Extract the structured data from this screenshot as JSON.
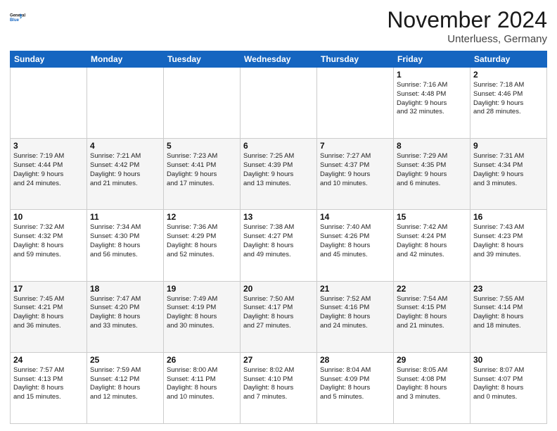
{
  "header": {
    "logo_line1": "General",
    "logo_line2": "Blue",
    "month_title": "November 2024",
    "location": "Unterluess, Germany"
  },
  "days_of_week": [
    "Sunday",
    "Monday",
    "Tuesday",
    "Wednesday",
    "Thursday",
    "Friday",
    "Saturday"
  ],
  "weeks": [
    [
      {
        "day": "",
        "info": ""
      },
      {
        "day": "",
        "info": ""
      },
      {
        "day": "",
        "info": ""
      },
      {
        "day": "",
        "info": ""
      },
      {
        "day": "",
        "info": ""
      },
      {
        "day": "1",
        "info": "Sunrise: 7:16 AM\nSunset: 4:48 PM\nDaylight: 9 hours\nand 32 minutes."
      },
      {
        "day": "2",
        "info": "Sunrise: 7:18 AM\nSunset: 4:46 PM\nDaylight: 9 hours\nand 28 minutes."
      }
    ],
    [
      {
        "day": "3",
        "info": "Sunrise: 7:19 AM\nSunset: 4:44 PM\nDaylight: 9 hours\nand 24 minutes."
      },
      {
        "day": "4",
        "info": "Sunrise: 7:21 AM\nSunset: 4:42 PM\nDaylight: 9 hours\nand 21 minutes."
      },
      {
        "day": "5",
        "info": "Sunrise: 7:23 AM\nSunset: 4:41 PM\nDaylight: 9 hours\nand 17 minutes."
      },
      {
        "day": "6",
        "info": "Sunrise: 7:25 AM\nSunset: 4:39 PM\nDaylight: 9 hours\nand 13 minutes."
      },
      {
        "day": "7",
        "info": "Sunrise: 7:27 AM\nSunset: 4:37 PM\nDaylight: 9 hours\nand 10 minutes."
      },
      {
        "day": "8",
        "info": "Sunrise: 7:29 AM\nSunset: 4:35 PM\nDaylight: 9 hours\nand 6 minutes."
      },
      {
        "day": "9",
        "info": "Sunrise: 7:31 AM\nSunset: 4:34 PM\nDaylight: 9 hours\nand 3 minutes."
      }
    ],
    [
      {
        "day": "10",
        "info": "Sunrise: 7:32 AM\nSunset: 4:32 PM\nDaylight: 8 hours\nand 59 minutes."
      },
      {
        "day": "11",
        "info": "Sunrise: 7:34 AM\nSunset: 4:30 PM\nDaylight: 8 hours\nand 56 minutes."
      },
      {
        "day": "12",
        "info": "Sunrise: 7:36 AM\nSunset: 4:29 PM\nDaylight: 8 hours\nand 52 minutes."
      },
      {
        "day": "13",
        "info": "Sunrise: 7:38 AM\nSunset: 4:27 PM\nDaylight: 8 hours\nand 49 minutes."
      },
      {
        "day": "14",
        "info": "Sunrise: 7:40 AM\nSunset: 4:26 PM\nDaylight: 8 hours\nand 45 minutes."
      },
      {
        "day": "15",
        "info": "Sunrise: 7:42 AM\nSunset: 4:24 PM\nDaylight: 8 hours\nand 42 minutes."
      },
      {
        "day": "16",
        "info": "Sunrise: 7:43 AM\nSunset: 4:23 PM\nDaylight: 8 hours\nand 39 minutes."
      }
    ],
    [
      {
        "day": "17",
        "info": "Sunrise: 7:45 AM\nSunset: 4:21 PM\nDaylight: 8 hours\nand 36 minutes."
      },
      {
        "day": "18",
        "info": "Sunrise: 7:47 AM\nSunset: 4:20 PM\nDaylight: 8 hours\nand 33 minutes."
      },
      {
        "day": "19",
        "info": "Sunrise: 7:49 AM\nSunset: 4:19 PM\nDaylight: 8 hours\nand 30 minutes."
      },
      {
        "day": "20",
        "info": "Sunrise: 7:50 AM\nSunset: 4:17 PM\nDaylight: 8 hours\nand 27 minutes."
      },
      {
        "day": "21",
        "info": "Sunrise: 7:52 AM\nSunset: 4:16 PM\nDaylight: 8 hours\nand 24 minutes."
      },
      {
        "day": "22",
        "info": "Sunrise: 7:54 AM\nSunset: 4:15 PM\nDaylight: 8 hours\nand 21 minutes."
      },
      {
        "day": "23",
        "info": "Sunrise: 7:55 AM\nSunset: 4:14 PM\nDaylight: 8 hours\nand 18 minutes."
      }
    ],
    [
      {
        "day": "24",
        "info": "Sunrise: 7:57 AM\nSunset: 4:13 PM\nDaylight: 8 hours\nand 15 minutes."
      },
      {
        "day": "25",
        "info": "Sunrise: 7:59 AM\nSunset: 4:12 PM\nDaylight: 8 hours\nand 12 minutes."
      },
      {
        "day": "26",
        "info": "Sunrise: 8:00 AM\nSunset: 4:11 PM\nDaylight: 8 hours\nand 10 minutes."
      },
      {
        "day": "27",
        "info": "Sunrise: 8:02 AM\nSunset: 4:10 PM\nDaylight: 8 hours\nand 7 minutes."
      },
      {
        "day": "28",
        "info": "Sunrise: 8:04 AM\nSunset: 4:09 PM\nDaylight: 8 hours\nand 5 minutes."
      },
      {
        "day": "29",
        "info": "Sunrise: 8:05 AM\nSunset: 4:08 PM\nDaylight: 8 hours\nand 3 minutes."
      },
      {
        "day": "30",
        "info": "Sunrise: 8:07 AM\nSunset: 4:07 PM\nDaylight: 8 hours\nand 0 minutes."
      }
    ]
  ]
}
